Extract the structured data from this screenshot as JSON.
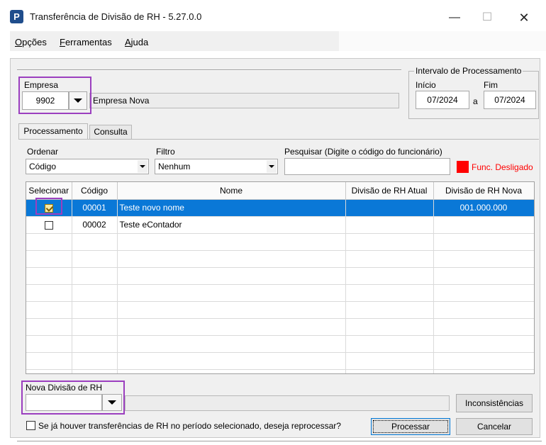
{
  "window": {
    "logo_letter": "P",
    "title": "Transferência de Divisão de RH - 5.27.0.0",
    "min_glyph": "—",
    "max_glyph": "☐",
    "close_glyph": "✕"
  },
  "menu": {
    "opcoes_accel": "O",
    "opcoes_rest": "pções",
    "ferramentas_accel": "F",
    "ferramentas_rest": "erramentas",
    "ajuda_accel": "A",
    "ajuda_rest": "juda"
  },
  "empresa": {
    "label": "Empresa",
    "code": "9902",
    "name": "Empresa Nova"
  },
  "intervalo": {
    "label": "Intervalo de Processamento",
    "inicio_label": "Início",
    "fim_label": "Fim",
    "inicio_value": "07/2024",
    "separator": "a",
    "fim_value": "07/2024"
  },
  "tabs": [
    {
      "label": "Processamento",
      "active": true
    },
    {
      "label": "Consulta",
      "active": false
    }
  ],
  "filters": {
    "ordenar_label": "Ordenar",
    "ordenar_value": "Código",
    "filtro_label": "Filtro",
    "filtro_value": "Nenhum",
    "pesquisar_label": "Pesquisar (Digite o código do funcionário)",
    "pesquisar_value": "",
    "legend_label": "Func. Desligado",
    "legend_color": "#ff0000"
  },
  "grid": {
    "columns": [
      "Selecionar",
      "Código",
      "Nome",
      "Divisão de RH Atual",
      "Divisão de RH Nova"
    ],
    "rows": [
      {
        "selected": true,
        "checked": true,
        "codigo": "00001",
        "nome": "Teste novo nome",
        "atual": "",
        "nova": "001.000.000"
      },
      {
        "selected": false,
        "checked": false,
        "codigo": "00002",
        "nome": "Teste eContador",
        "atual": "",
        "nova": ""
      }
    ],
    "selection_color": "#0a78d7"
  },
  "bottom": {
    "nova_label": "Nova Divisão de RH",
    "nova_value": "",
    "inconsistencias_label": "Inconsistências",
    "reprocess_label": "Se já houver transferências de RH no período selecionado, deseja reprocessar?",
    "reprocess_checked": false,
    "processar_label": "Processar",
    "cancelar_label": "Cancelar"
  },
  "highlight_color": "#9b3fbf"
}
